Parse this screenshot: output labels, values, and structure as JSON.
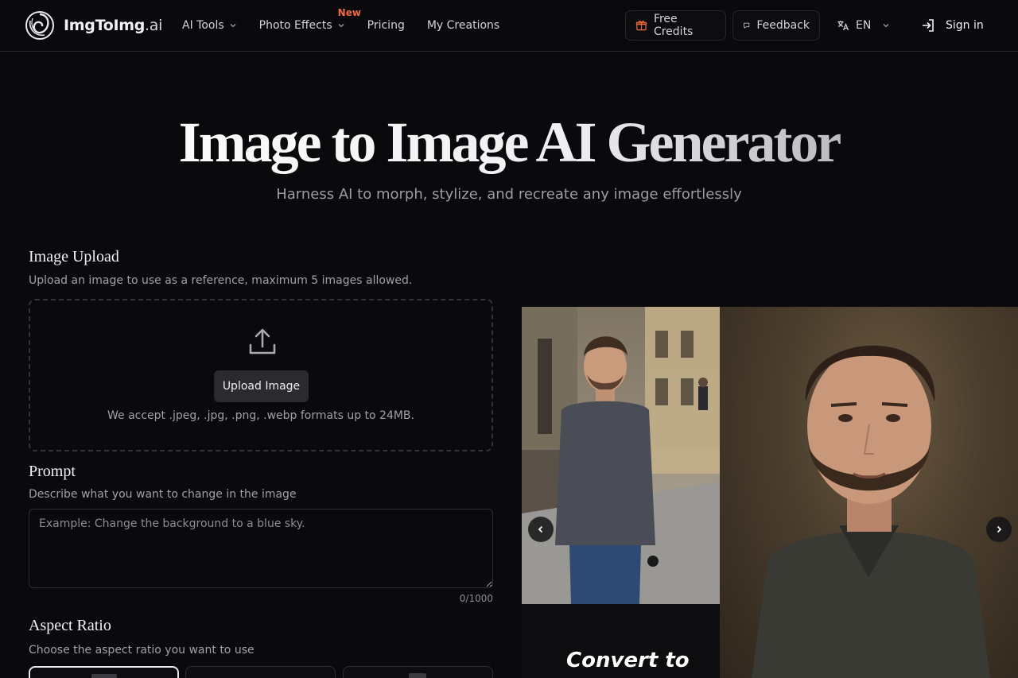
{
  "brand": {
    "name": "ImgToImg",
    "suffix": ".ai"
  },
  "nav": {
    "ai_tools": "AI Tools",
    "photo_effects": "Photo Effects",
    "new_badge": "New",
    "pricing": "Pricing",
    "my_creations": "My Creations"
  },
  "header_actions": {
    "free_credits": "Free Credits",
    "feedback": "Feedback",
    "language": "EN",
    "sign_in": "Sign in"
  },
  "hero": {
    "title": "Image to Image AI Generator",
    "subtitle": "Harness AI to morph, stylize, and recreate any image effortlessly"
  },
  "upload": {
    "title": "Image Upload",
    "description": "Upload an image to use as a reference, maximum 5 images allowed.",
    "button": "Upload Image",
    "note": "We accept .jpeg, .jpg, .png, .webp formats up to 24MB."
  },
  "prompt": {
    "title": "Prompt",
    "description": "Describe what you want to change in the image",
    "placeholder": "Example: Change the background to a blue sky.",
    "value": "",
    "counter": "0/1000"
  },
  "aspect_ratio": {
    "title": "Aspect Ratio",
    "description": "Choose the aspect ratio you want to use"
  },
  "showcase": {
    "caption": "Convert to"
  },
  "colors": {
    "background": "#0a0a0c",
    "accent_new": "#f26a3d",
    "border": "#26262b"
  },
  "icons": {
    "logo": "spiral-logo-icon",
    "credits": "gift-icon",
    "feedback": "message-square-icon",
    "language": "translate-icon",
    "sign_in": "log-in-icon",
    "upload": "upload-icon",
    "prev": "chevron-left-icon",
    "next": "chevron-right-icon"
  }
}
